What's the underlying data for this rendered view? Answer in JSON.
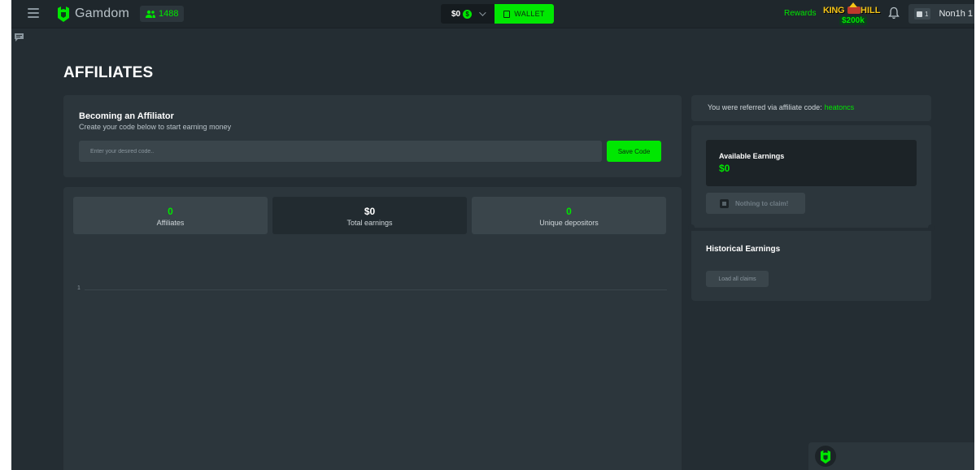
{
  "header": {
    "brand": "Gamdom",
    "online_count": "1488",
    "balance": "$0",
    "coin_symbol": "$",
    "wallet_label": "WALLET",
    "rewards_label": "Rewards",
    "promo": {
      "line1_left": "KING",
      "line1_right": "HILL",
      "prize": "$200k"
    },
    "user": {
      "level": "1",
      "name": "Non1h 1"
    }
  },
  "page": {
    "title": "AFFILIATES"
  },
  "become": {
    "title": "Becoming an Affiliator",
    "subtitle": "Create your code below to start earning money",
    "input_placeholder": "Enter your desired code..",
    "input_value": "",
    "save_label": "Save Code"
  },
  "stats": [
    {
      "value": "0",
      "label": "Affiliates"
    },
    {
      "value": "$0",
      "label": "Total earnings"
    },
    {
      "value": "0",
      "label": "Unique depositors"
    }
  ],
  "chart": {
    "y_tick": "1"
  },
  "referral": {
    "text": "You were referred via affiliate code:",
    "code": "heatoncs"
  },
  "earnings": {
    "title": "Available Earnings",
    "value": "$0",
    "claim_label": "Nothing to claim!"
  },
  "history": {
    "title": "Historical Earnings",
    "load_label": "Load all claims"
  },
  "colors": {
    "accent": "#00e701",
    "background": "#242d33",
    "panel": "#2c363c",
    "topbar": "#1f272c"
  },
  "icons": [
    "menu-icon",
    "gamdom-logo-icon",
    "users-icon",
    "coin-icon",
    "chevron-down-icon",
    "wallet-icon",
    "bell-icon",
    "level-icon",
    "chat-icon",
    "gift-icon"
  ]
}
